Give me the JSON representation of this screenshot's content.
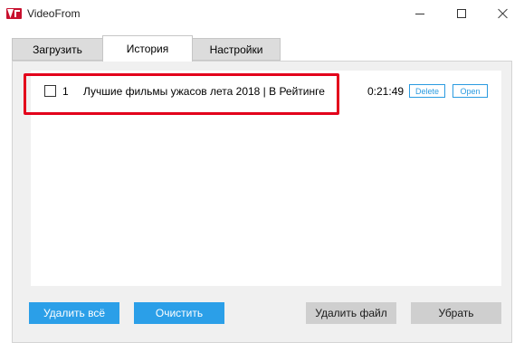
{
  "window": {
    "title": "VideoFrom"
  },
  "tabs": [
    {
      "label": "Загрузить",
      "active": false
    },
    {
      "label": "История",
      "active": true
    },
    {
      "label": "Настройки",
      "active": false
    }
  ],
  "history": {
    "items": [
      {
        "checked": false,
        "number": "1",
        "title": "Лучшие фильмы ужасов лета 2018 | В Рейтинге",
        "duration": "0:21:49",
        "delete_label": "Delete",
        "open_label": "Open"
      }
    ]
  },
  "actions": {
    "delete_all_label": "Удалить всё",
    "clear_label": "Очистить",
    "delete_file_label": "Удалить файл",
    "remove_label": "Убрать"
  },
  "colors": {
    "accent": "#2b9fe8",
    "highlight": "#e3001b",
    "brand": "#c8102e"
  }
}
